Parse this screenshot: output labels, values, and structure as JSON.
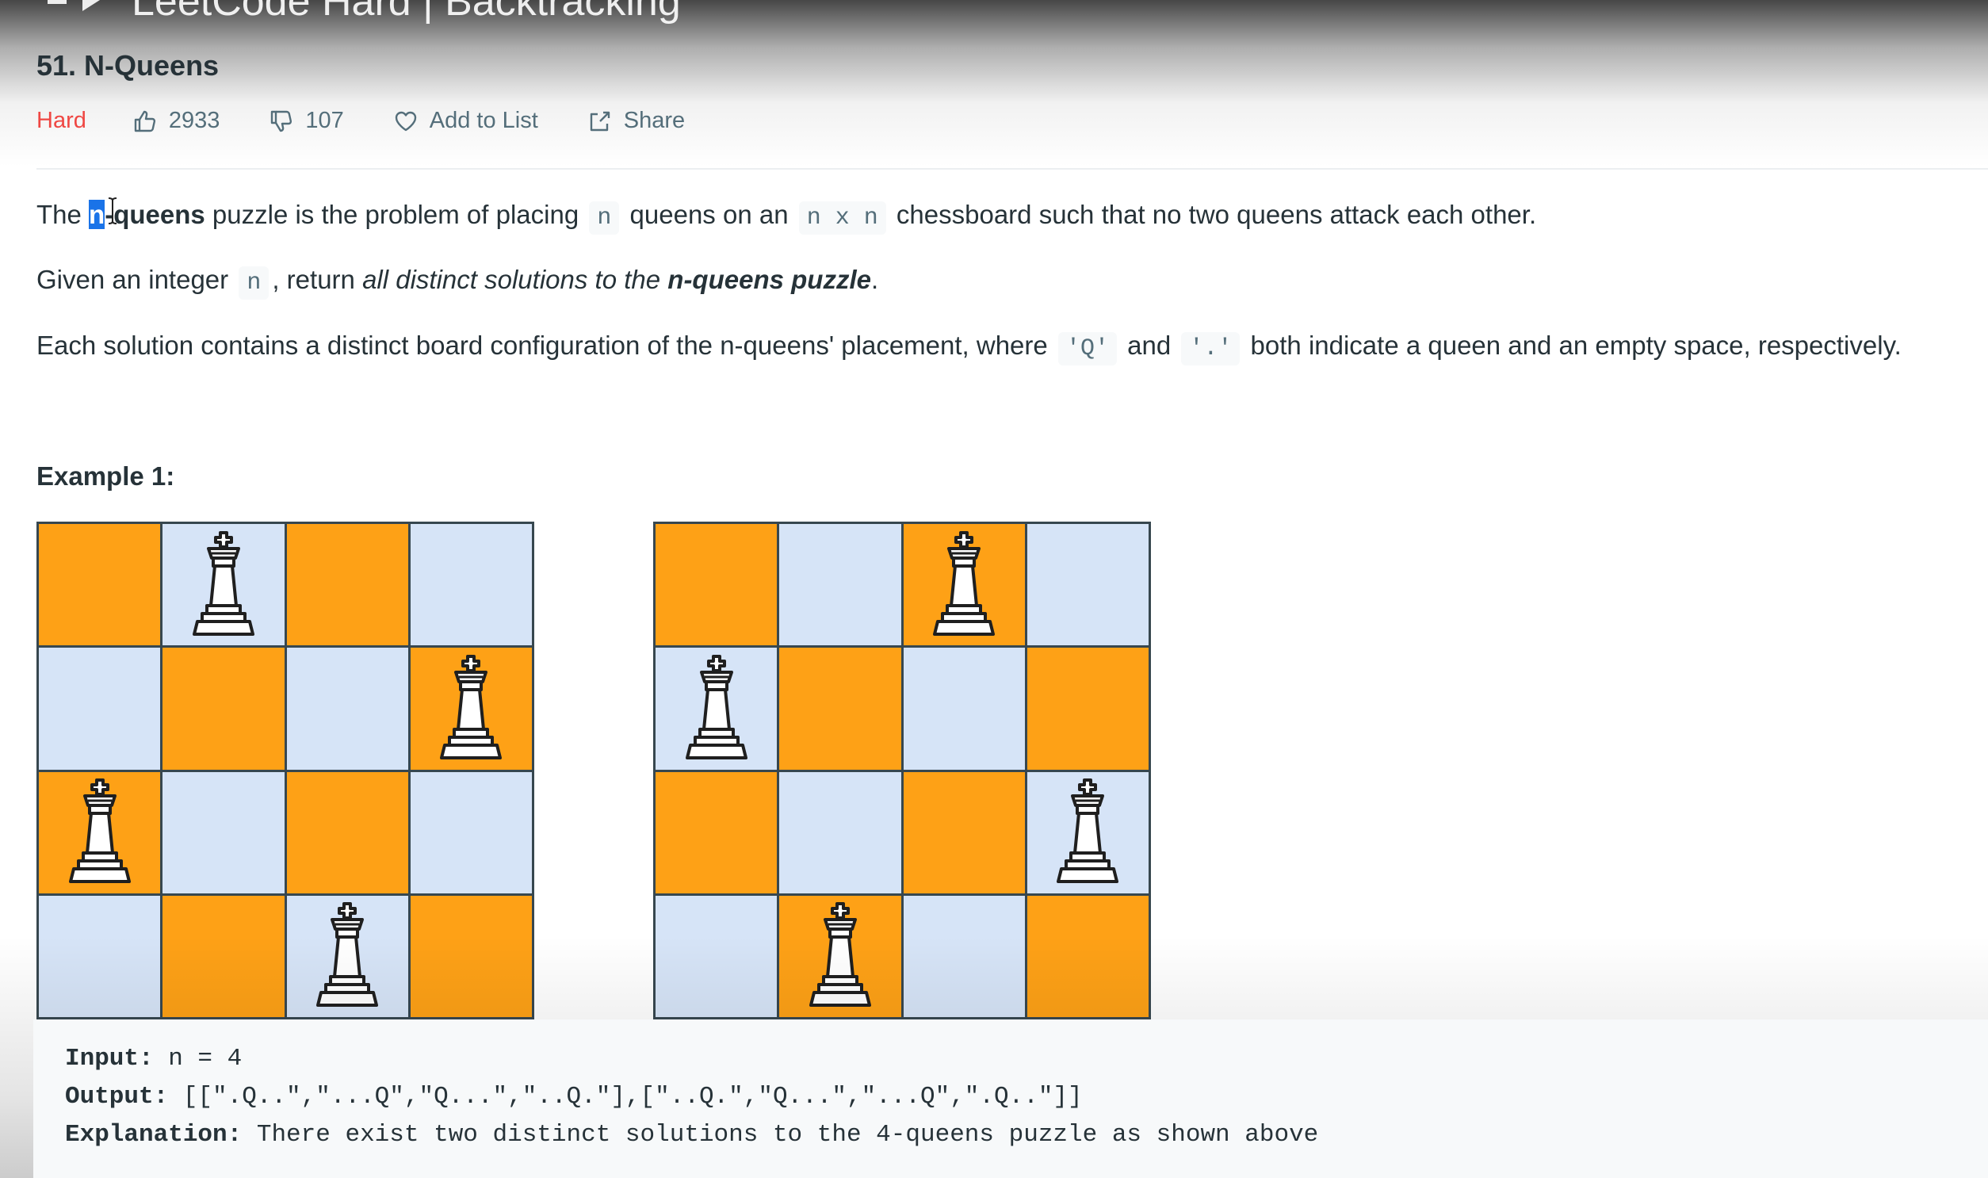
{
  "video": {
    "title": "LeetCode Hard | Backtracking"
  },
  "problem": {
    "title": "51. N-Queens",
    "difficulty": "Hard",
    "likes": "2933",
    "dislikes": "107",
    "add_to_list": "Add to List",
    "share": "Share"
  },
  "description": {
    "p1_the": "The",
    "p1_highlight": "n",
    "p1_bold": "-queens",
    "p1_a": " puzzle is the problem of placing",
    "p1_code1": "n",
    "p1_b": "queens on an",
    "p1_code2": "n x n",
    "p1_c": "chessboard such that no two queens attack each other.",
    "p2_a": "Given an integer",
    "p2_code": "n",
    "p2_b": ", return ",
    "p2_italic": "all distinct solutions to the ",
    "p2_bold_italic": "n-queens puzzle",
    "p2_end": ".",
    "p3_a": "Each solution contains a distinct board configuration of the n-queens' placement, where",
    "p3_code1": "'Q'",
    "p3_b": "and",
    "p3_code2": "'.'",
    "p3_c": "both indicate a queen and an empty space, respectively."
  },
  "example": {
    "title": "Example 1:",
    "boards": [
      [
        ".Q..",
        "...Q",
        "Q...",
        "..Q."
      ],
      [
        "..Q.",
        "Q...",
        "...Q",
        ".Q.."
      ]
    ],
    "input_label": "Input:",
    "input_value": " n = 4",
    "output_label": "Output:",
    "output_value": " [[\".Q..\",\"...Q\",\"Q...\",\"..Q.\"],[\"..Q.\",\"Q...\",\"...Q\",\".Q..\"]]",
    "explanation_label": "Explanation:",
    "explanation_value": " There exist two distinct solutions to the 4-queens puzzle as shown above"
  },
  "colors": {
    "difficulty_hard": "#ef4743",
    "board_dark": "#fea116",
    "board_light": "#d6e4f7",
    "highlight": "#1a73e8"
  },
  "icons": [
    "playlist-icon",
    "thumbs-up-icon",
    "thumbs-down-icon",
    "heart-icon",
    "share-icon",
    "queen-icon",
    "text-cursor-icon"
  ]
}
